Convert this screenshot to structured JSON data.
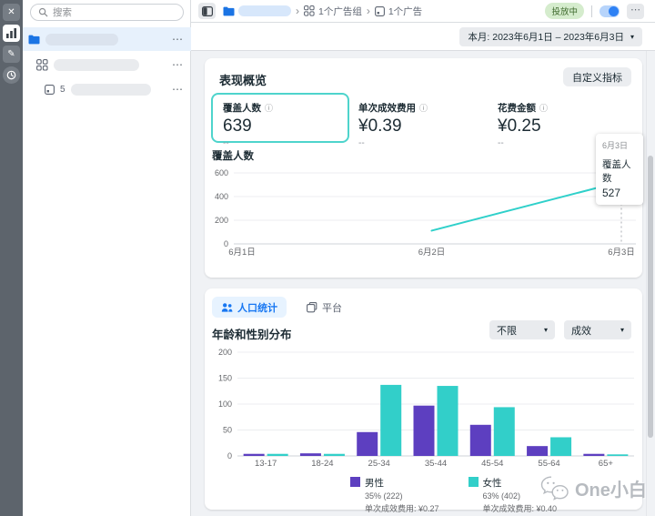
{
  "icons": {
    "close": "✕",
    "pencil": "✎",
    "dots": "⋯",
    "caret": "▾",
    "chevron": "›",
    "info": "ⓘ"
  },
  "sidebar": {
    "search_placeholder": "搜索",
    "ad_prefix": "5"
  },
  "header": {
    "breadcrumb": {
      "adset_label": "1个广告组",
      "ad_label": "1个广告"
    },
    "status_badge": "投放中"
  },
  "toolbar": {
    "date_range": "本月: 2023年6月1日 – 2023年6月3日"
  },
  "overview": {
    "title": "表现概览",
    "customize_button": "自定义指标",
    "metrics": [
      {
        "label": "覆盖人数",
        "value": "639",
        "sub": "--"
      },
      {
        "label": "单次成效费用",
        "value": "¥0.39",
        "sub": "--"
      },
      {
        "label": "花费金额",
        "value": "¥0.25",
        "sub": "--"
      }
    ],
    "chart_title": "覆盖人数",
    "tooltip": {
      "date": "6月3日",
      "label": "覆盖人数",
      "value": "527"
    }
  },
  "demographics": {
    "tabs": [
      {
        "label": "人口统计"
      },
      {
        "label": "平台"
      }
    ],
    "section_title": "年龄和性别分布",
    "filters": [
      {
        "value": "不限"
      },
      {
        "value": "成效"
      }
    ],
    "legend": [
      {
        "name": "男性",
        "share": "35% (222)",
        "cost": "单次成效费用: ¥0.27",
        "color": "#5d3fc0"
      },
      {
        "name": "女性",
        "share": "63% (402)",
        "cost": "单次成效费用: ¥0.40",
        "color": "#32cfc9"
      }
    ]
  },
  "watermark": "One小白",
  "colors": {
    "accent_blue": "#1877f2",
    "teal": "#2fd0ca",
    "purple": "#5d3fc0",
    "badge_green_bg": "#d5eccd",
    "badge_green_text": "#3f6b2e",
    "page_bg": "#f0f2f5"
  },
  "chart_data": [
    {
      "type": "line",
      "title": "覆盖人数",
      "x": [
        "6月1日",
        "6月2日",
        "6月3日"
      ],
      "series": [
        {
          "name": "覆盖人数",
          "values": [
            null,
            112,
            527
          ],
          "color": "#2fd0ca"
        }
      ],
      "ylim": [
        0,
        600
      ],
      "yticks": [
        0,
        200,
        400,
        600
      ],
      "grid": true,
      "annotation": {
        "x": "6月3日",
        "value": 527,
        "marker": "hollow-circle",
        "dropline": "dotted"
      }
    },
    {
      "type": "bar",
      "title": "年龄和性别分布",
      "categories": [
        "13-17",
        "18-24",
        "25-34",
        "35-44",
        "45-54",
        "55-64",
        "65+"
      ],
      "series": [
        {
          "name": "男性",
          "color": "#5d3fc0",
          "values": [
            4,
            5,
            46,
            97,
            60,
            19,
            4
          ]
        },
        {
          "name": "女性",
          "color": "#32cfc9",
          "values": [
            4,
            4,
            137,
            135,
            94,
            36,
            3
          ]
        }
      ],
      "ylim": [
        0,
        200
      ],
      "yticks": [
        0,
        50,
        100,
        150,
        200
      ],
      "grid": true,
      "legend_position": "bottom"
    }
  ]
}
